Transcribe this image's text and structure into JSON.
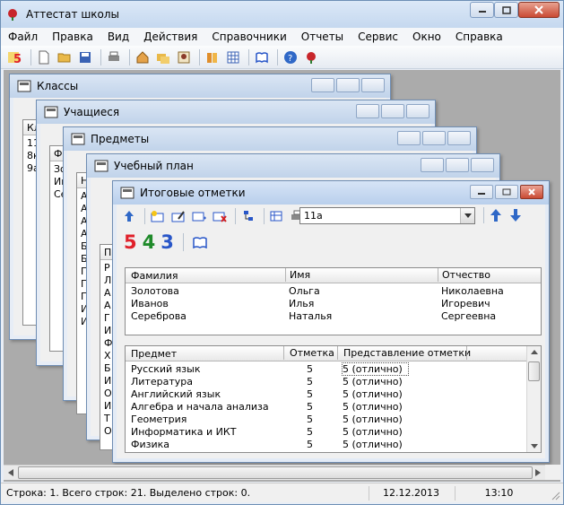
{
  "app": {
    "title": "Аттестат школы"
  },
  "menu": [
    "Файл",
    "Правка",
    "Вид",
    "Действия",
    "Справочники",
    "Отчеты",
    "Сервис",
    "Окно",
    "Справка"
  ],
  "windows": {
    "classes": {
      "title": "Классы",
      "col": "Кл",
      "rows": [
        "11",
        "8к",
        "9а"
      ]
    },
    "students": {
      "title": "Учащиеся",
      "col": "Ф",
      "rows": [
        "Зо",
        "Ив",
        "Се"
      ]
    },
    "subjects": {
      "title": "Предметы",
      "col": "Н",
      "rows": [
        "А",
        "А",
        "А",
        "А",
        "Б",
        "Б",
        "Г",
        "Г",
        "Г",
        "И",
        "И"
      ]
    },
    "plan": {
      "title": "Учебный план",
      "col": "П",
      "rows": [
        "Р",
        "Л",
        "А",
        "А",
        "Г",
        "И",
        "Ф",
        "Х",
        "Б",
        "И",
        "О",
        "И",
        "Т",
        "О"
      ]
    }
  },
  "grades": {
    "title": "Итоговые отметки",
    "class_value": "11а",
    "big_digits": [
      "5",
      "4",
      "3"
    ],
    "students_headers": [
      "Фамилия",
      "Имя",
      "Отчество"
    ],
    "students": [
      {
        "last": "Золотова",
        "first": "Ольга",
        "patronymic": "Николаевна"
      },
      {
        "last": "Иванов",
        "first": "Илья",
        "patronymic": "Игоревич"
      },
      {
        "last": "Сереброва",
        "first": "Наталья",
        "patronymic": "Сергеевна"
      }
    ],
    "marks_headers": [
      "Предмет",
      "Отметка",
      "Представление отметки"
    ],
    "marks": [
      {
        "subject": "Русский язык",
        "mark": "5",
        "repr": "5 (отлично)"
      },
      {
        "subject": "Литература",
        "mark": "5",
        "repr": "5 (отлично)"
      },
      {
        "subject": "Английский язык",
        "mark": "5",
        "repr": "5 (отлично)"
      },
      {
        "subject": "Алгебра и начала анализа",
        "mark": "5",
        "repr": "5 (отлично)"
      },
      {
        "subject": "Геометрия",
        "mark": "5",
        "repr": "5 (отлично)"
      },
      {
        "subject": "Информатика и ИКТ",
        "mark": "5",
        "repr": "5 (отлично)"
      },
      {
        "subject": "Физика",
        "mark": "5",
        "repr": "5 (отлично)"
      }
    ]
  },
  "status": {
    "text": "Строка: 1. Всего строк: 21. Выделено строк: 0.",
    "date": "12.12.2013",
    "time": "13:10"
  },
  "colors": {
    "five": "#e0202a",
    "four": "#1f8a2a",
    "three": "#2856c8"
  }
}
